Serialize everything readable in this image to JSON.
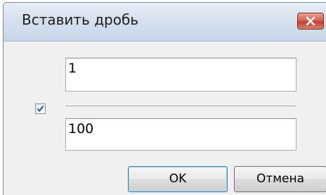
{
  "dialog": {
    "title": "Вставить дробь",
    "close_icon": "close-icon"
  },
  "fraction": {
    "numerator": "1",
    "denominator": "100",
    "line_checkbox_checked": true
  },
  "buttons": {
    "ok_label": "OK",
    "cancel_label": "Отмена"
  },
  "colors": {
    "title_bar": "#d5e1ef",
    "close_button": "#c2412b",
    "checkmark": "#2150a8",
    "dialog_background": "#f0f0f0"
  }
}
